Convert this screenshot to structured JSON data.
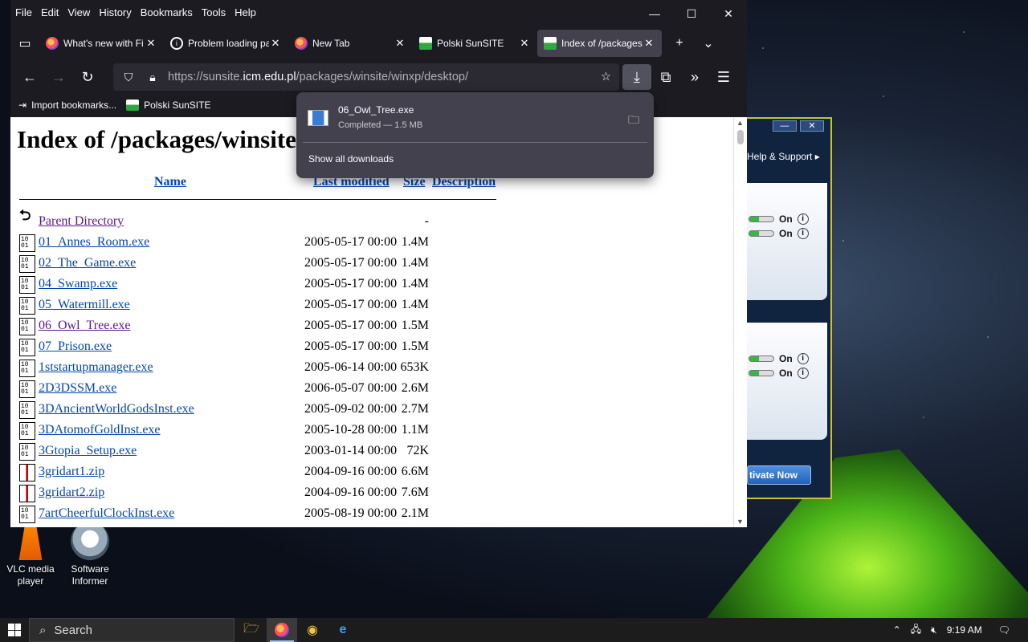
{
  "browser": {
    "menu": [
      "File",
      "Edit",
      "View",
      "History",
      "Bookmarks",
      "Tools",
      "Help"
    ],
    "tabs": [
      {
        "title": "What's new with Fi",
        "favicon": "firefox-icon"
      },
      {
        "title": "Problem loading pa",
        "favicon": "info-icon"
      },
      {
        "title": "New Tab",
        "favicon": "firefox-icon"
      },
      {
        "title": "Polski SunSITE",
        "favicon": "sunsite-icon"
      },
      {
        "title": "Index of /packages",
        "favicon": "sunsite-icon",
        "active": true
      }
    ],
    "url_prefix": "https://sunsite.",
    "url_host": "icm.edu.pl",
    "url_path": "/packages/winsite/winxp/desktop/",
    "bookmarks": [
      {
        "label": "Import bookmarks...",
        "icon": "import-icon"
      },
      {
        "label": "Polski SunSITE",
        "icon": "sunsite-icon"
      }
    ]
  },
  "page": {
    "title": "Index of /packages/winsite",
    "columns": {
      "name": "Name",
      "modified": "Last modified",
      "size": "Size",
      "description": "Description"
    },
    "parent": {
      "name": "Parent Directory",
      "size": "-"
    },
    "entries": [
      {
        "name": "01_Annes_Room.exe",
        "modified": "2005-05-17 00:00",
        "size": "1.4M",
        "type": "exe"
      },
      {
        "name": "02_The_Game.exe",
        "modified": "2005-05-17 00:00",
        "size": "1.4M",
        "type": "exe"
      },
      {
        "name": "04_Swamp.exe",
        "modified": "2005-05-17 00:00",
        "size": "1.4M",
        "type": "exe"
      },
      {
        "name": "05_Watermill.exe",
        "modified": "2005-05-17 00:00",
        "size": "1.4M",
        "type": "exe"
      },
      {
        "name": "06_Owl_Tree.exe",
        "modified": "2005-05-17 00:00",
        "size": "1.5M",
        "type": "exe",
        "visited": true
      },
      {
        "name": "07_Prison.exe",
        "modified": "2005-05-17 00:00",
        "size": "1.5M",
        "type": "exe"
      },
      {
        "name": "1ststartupmanager.exe",
        "modified": "2005-06-14 00:00",
        "size": "653K",
        "type": "exe"
      },
      {
        "name": "2D3DSSM.exe",
        "modified": "2006-05-07 00:00",
        "size": "2.6M",
        "type": "exe"
      },
      {
        "name": "3DAncientWorldGodsInst.exe",
        "modified": "2005-09-02 00:00",
        "size": "2.7M",
        "type": "exe"
      },
      {
        "name": "3DAtomofGoldInst.exe",
        "modified": "2005-10-28 00:00",
        "size": "1.1M",
        "type": "exe"
      },
      {
        "name": "3Gtopia_Setup.exe",
        "modified": "2003-01-14 00:00",
        "size": "72K",
        "type": "exe"
      },
      {
        "name": "3gridart1.zip",
        "modified": "2004-09-16 00:00",
        "size": "6.6M",
        "type": "zip"
      },
      {
        "name": "3gridart2.zip",
        "modified": "2004-09-16 00:00",
        "size": "7.6M",
        "type": "zip"
      },
      {
        "name": "7artCheerfulClockInst.exe",
        "modified": "2005-08-19 00:00",
        "size": "2.1M",
        "type": "exe"
      }
    ]
  },
  "downloads": {
    "file": "06_Owl_Tree.exe",
    "status": "Completed — 1.5 MB",
    "show_all": "Show all downloads"
  },
  "bg_app": {
    "help": "Help & Support",
    "on_label": "On",
    "activate": "tivate Now"
  },
  "desktop_icons": [
    {
      "label_line1": "VLC media",
      "label_line2": "player"
    },
    {
      "label_line1": "Software",
      "label_line2": "Informer"
    }
  ],
  "taskbar": {
    "search": "Search",
    "time": "9:19 AM"
  }
}
